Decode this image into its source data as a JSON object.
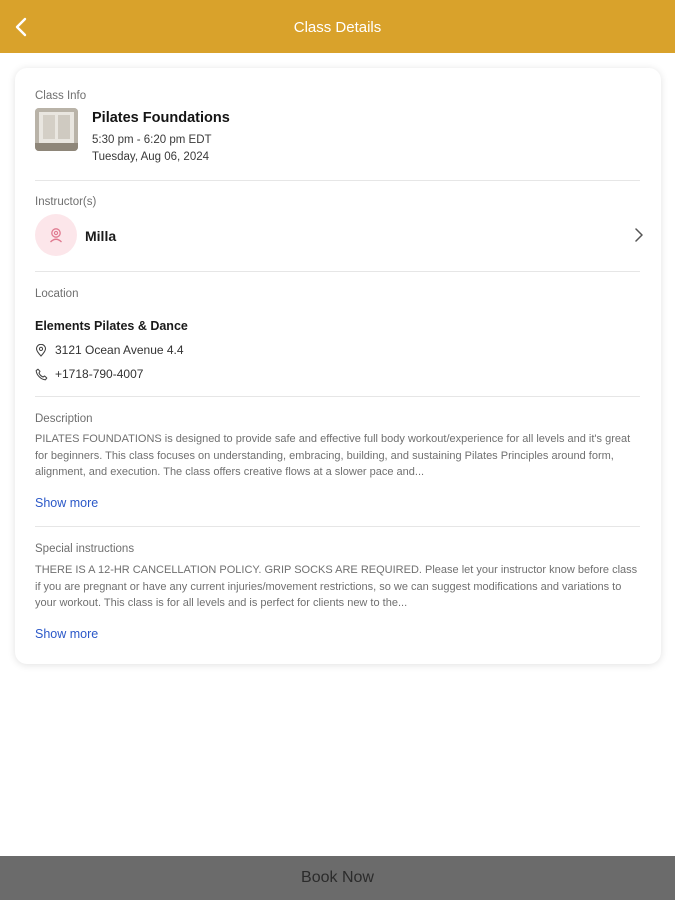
{
  "header": {
    "title": "Class Details",
    "back_icon": "chevron-left-icon",
    "color": "#d9a22b"
  },
  "class_info": {
    "label": "Class Info",
    "name": "Pilates Foundations",
    "time": "5:30 pm - 6:20 pm EDT",
    "date": "Tuesday, Aug 06, 2024"
  },
  "instructors": {
    "label": "Instructor(s)",
    "items": [
      {
        "name": "Milla",
        "avatar_icon": "instructor-avatar-icon"
      }
    ]
  },
  "location": {
    "label": "Location",
    "name": "Elements Pilates & Dance",
    "address": "3121 Ocean Avenue 4.4",
    "phone": "+1718-790-4007"
  },
  "description": {
    "label": "Description",
    "text": "PILATES FOUNDATIONS is designed to provide safe and effective full body workout/experience for all levels and it's great for beginners. This class focuses on understanding, embracing, building, and sustaining Pilates Principles around form, alignment, and execution. The class offers creative flows at a slower pace and...",
    "show_more": "Show more"
  },
  "special_instructions": {
    "label": "Special instructions",
    "text": "THERE IS A 12-HR CANCELLATION POLICY.  GRIP SOCKS ARE REQUIRED. Please let your instructor know before class if you are pregnant or have any current injuries/movement restrictions, so we can suggest modifications and variations to your workout. This class is for all levels and is perfect for clients new to the...",
    "show_more": "Show more"
  },
  "footer": {
    "book_label": "Book Now"
  },
  "colors": {
    "accent": "#d9a22b",
    "link": "#2b58c8",
    "book_button": "#6b6b6b"
  }
}
